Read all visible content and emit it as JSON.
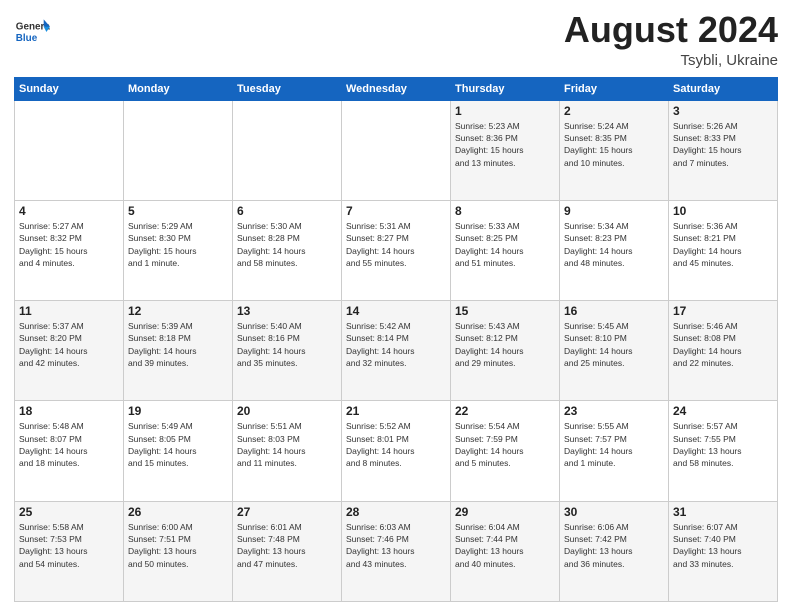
{
  "header": {
    "logo": {
      "general": "General",
      "blue": "Blue"
    },
    "title": "August 2024",
    "subtitle": "Tsybli, Ukraine"
  },
  "calendar": {
    "headers": [
      "Sunday",
      "Monday",
      "Tuesday",
      "Wednesday",
      "Thursday",
      "Friday",
      "Saturday"
    ],
    "weeks": [
      [
        {
          "day": "",
          "info": ""
        },
        {
          "day": "",
          "info": ""
        },
        {
          "day": "",
          "info": ""
        },
        {
          "day": "",
          "info": ""
        },
        {
          "day": "1",
          "info": "Sunrise: 5:23 AM\nSunset: 8:36 PM\nDaylight: 15 hours\nand 13 minutes."
        },
        {
          "day": "2",
          "info": "Sunrise: 5:24 AM\nSunset: 8:35 PM\nDaylight: 15 hours\nand 10 minutes."
        },
        {
          "day": "3",
          "info": "Sunrise: 5:26 AM\nSunset: 8:33 PM\nDaylight: 15 hours\nand 7 minutes."
        }
      ],
      [
        {
          "day": "4",
          "info": "Sunrise: 5:27 AM\nSunset: 8:32 PM\nDaylight: 15 hours\nand 4 minutes."
        },
        {
          "day": "5",
          "info": "Sunrise: 5:29 AM\nSunset: 8:30 PM\nDaylight: 15 hours\nand 1 minute."
        },
        {
          "day": "6",
          "info": "Sunrise: 5:30 AM\nSunset: 8:28 PM\nDaylight: 14 hours\nand 58 minutes."
        },
        {
          "day": "7",
          "info": "Sunrise: 5:31 AM\nSunset: 8:27 PM\nDaylight: 14 hours\nand 55 minutes."
        },
        {
          "day": "8",
          "info": "Sunrise: 5:33 AM\nSunset: 8:25 PM\nDaylight: 14 hours\nand 51 minutes."
        },
        {
          "day": "9",
          "info": "Sunrise: 5:34 AM\nSunset: 8:23 PM\nDaylight: 14 hours\nand 48 minutes."
        },
        {
          "day": "10",
          "info": "Sunrise: 5:36 AM\nSunset: 8:21 PM\nDaylight: 14 hours\nand 45 minutes."
        }
      ],
      [
        {
          "day": "11",
          "info": "Sunrise: 5:37 AM\nSunset: 8:20 PM\nDaylight: 14 hours\nand 42 minutes."
        },
        {
          "day": "12",
          "info": "Sunrise: 5:39 AM\nSunset: 8:18 PM\nDaylight: 14 hours\nand 39 minutes."
        },
        {
          "day": "13",
          "info": "Sunrise: 5:40 AM\nSunset: 8:16 PM\nDaylight: 14 hours\nand 35 minutes."
        },
        {
          "day": "14",
          "info": "Sunrise: 5:42 AM\nSunset: 8:14 PM\nDaylight: 14 hours\nand 32 minutes."
        },
        {
          "day": "15",
          "info": "Sunrise: 5:43 AM\nSunset: 8:12 PM\nDaylight: 14 hours\nand 29 minutes."
        },
        {
          "day": "16",
          "info": "Sunrise: 5:45 AM\nSunset: 8:10 PM\nDaylight: 14 hours\nand 25 minutes."
        },
        {
          "day": "17",
          "info": "Sunrise: 5:46 AM\nSunset: 8:08 PM\nDaylight: 14 hours\nand 22 minutes."
        }
      ],
      [
        {
          "day": "18",
          "info": "Sunrise: 5:48 AM\nSunset: 8:07 PM\nDaylight: 14 hours\nand 18 minutes."
        },
        {
          "day": "19",
          "info": "Sunrise: 5:49 AM\nSunset: 8:05 PM\nDaylight: 14 hours\nand 15 minutes."
        },
        {
          "day": "20",
          "info": "Sunrise: 5:51 AM\nSunset: 8:03 PM\nDaylight: 14 hours\nand 11 minutes."
        },
        {
          "day": "21",
          "info": "Sunrise: 5:52 AM\nSunset: 8:01 PM\nDaylight: 14 hours\nand 8 minutes."
        },
        {
          "day": "22",
          "info": "Sunrise: 5:54 AM\nSunset: 7:59 PM\nDaylight: 14 hours\nand 5 minutes."
        },
        {
          "day": "23",
          "info": "Sunrise: 5:55 AM\nSunset: 7:57 PM\nDaylight: 14 hours\nand 1 minute."
        },
        {
          "day": "24",
          "info": "Sunrise: 5:57 AM\nSunset: 7:55 PM\nDaylight: 13 hours\nand 58 minutes."
        }
      ],
      [
        {
          "day": "25",
          "info": "Sunrise: 5:58 AM\nSunset: 7:53 PM\nDaylight: 13 hours\nand 54 minutes."
        },
        {
          "day": "26",
          "info": "Sunrise: 6:00 AM\nSunset: 7:51 PM\nDaylight: 13 hours\nand 50 minutes."
        },
        {
          "day": "27",
          "info": "Sunrise: 6:01 AM\nSunset: 7:48 PM\nDaylight: 13 hours\nand 47 minutes."
        },
        {
          "day": "28",
          "info": "Sunrise: 6:03 AM\nSunset: 7:46 PM\nDaylight: 13 hours\nand 43 minutes."
        },
        {
          "day": "29",
          "info": "Sunrise: 6:04 AM\nSunset: 7:44 PM\nDaylight: 13 hours\nand 40 minutes."
        },
        {
          "day": "30",
          "info": "Sunrise: 6:06 AM\nSunset: 7:42 PM\nDaylight: 13 hours\nand 36 minutes."
        },
        {
          "day": "31",
          "info": "Sunrise: 6:07 AM\nSunset: 7:40 PM\nDaylight: 13 hours\nand 33 minutes."
        }
      ]
    ]
  }
}
